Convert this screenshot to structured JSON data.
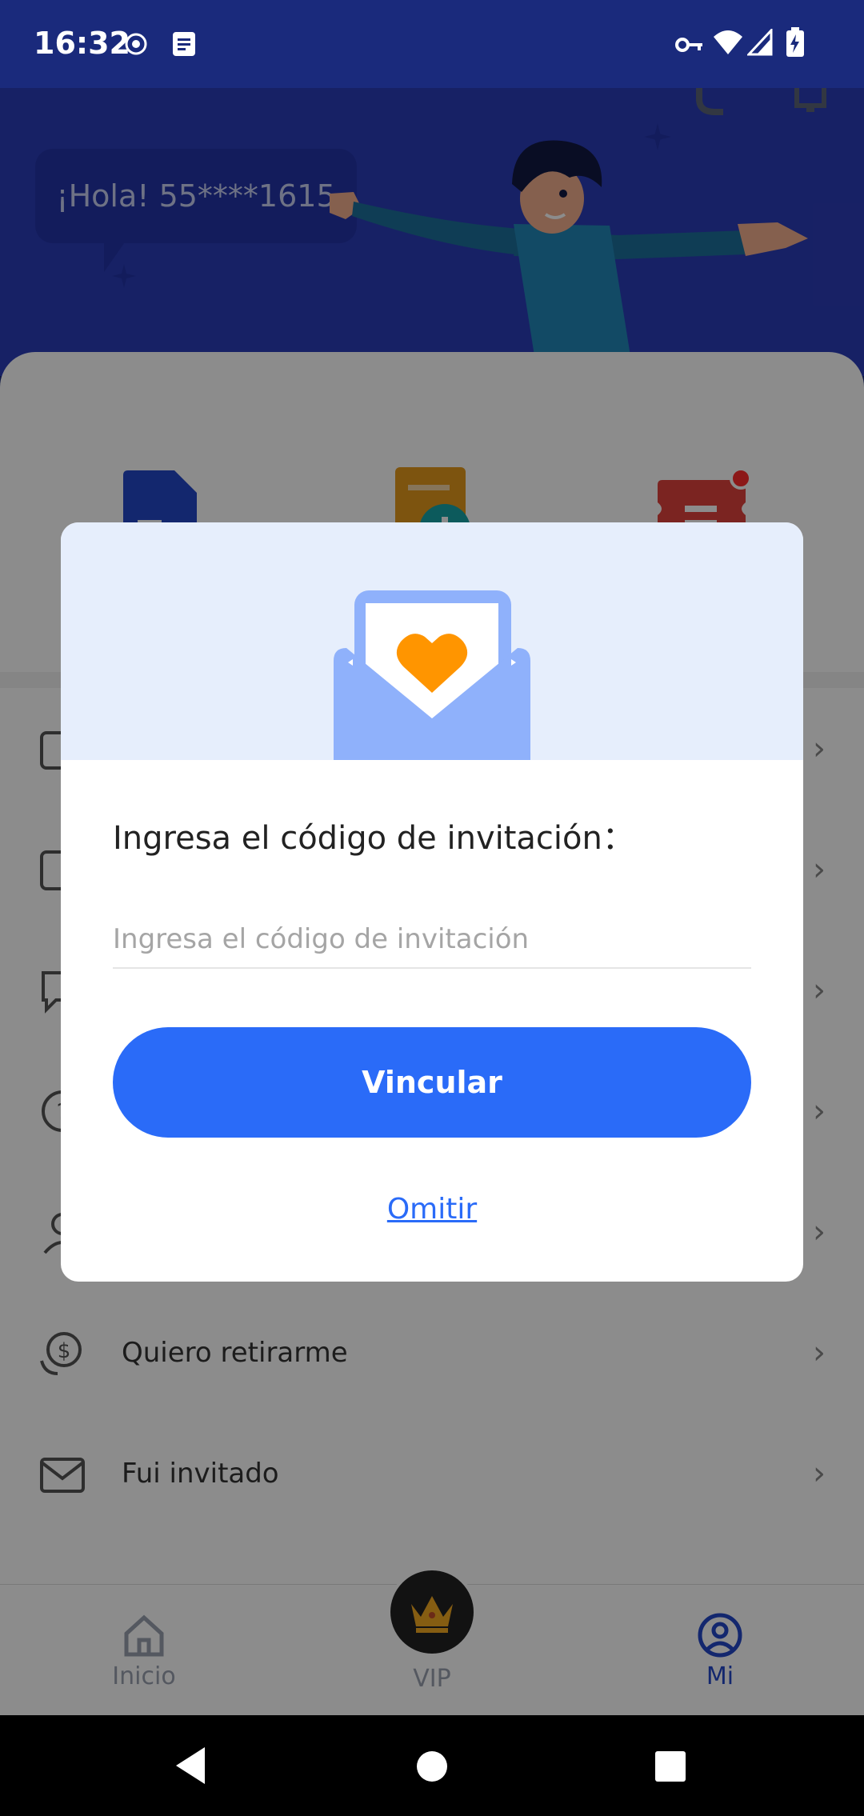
{
  "status_bar": {
    "time": "16:32"
  },
  "header": {
    "greeting": "¡Hola! 55****1615"
  },
  "menu": {
    "items": [
      {
        "label": "",
        "icon": "wallet-icon"
      },
      {
        "label": "",
        "icon": "edit-icon"
      },
      {
        "label": "",
        "icon": "chat-icon"
      },
      {
        "label": "",
        "icon": "help-icon"
      },
      {
        "label": "",
        "icon": "user-icon"
      },
      {
        "label": "Quiero retirarme",
        "icon": "dollar-icon"
      },
      {
        "label": "Fui invitado",
        "icon": "envelope-icon"
      }
    ]
  },
  "bottom_nav": {
    "home": "Inicio",
    "vip": "VIP",
    "me": "Mi"
  },
  "dialog": {
    "title": "Ingresa el código de invitación：",
    "input_placeholder": "Ingresa el código de invitación",
    "input_value": "",
    "bind_label": "Vincular",
    "skip_label": "Omitir"
  },
  "colors": {
    "primary": "#2a6bf8",
    "header_bg": "#2b3db8",
    "status_bg": "#1a2a7c",
    "heart": "#ff9500"
  }
}
